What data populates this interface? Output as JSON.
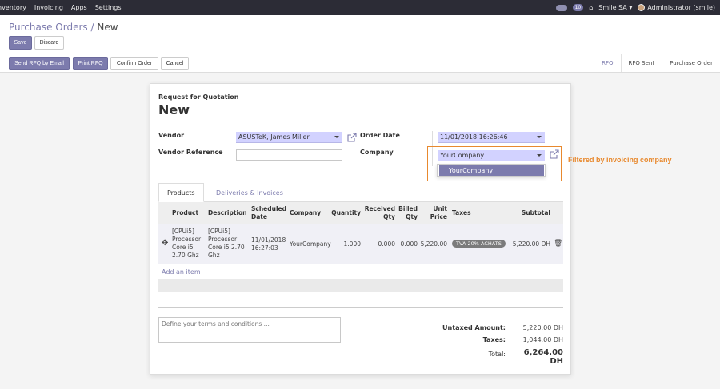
{
  "topbar": {
    "menu": [
      "nventory",
      "Invoicing",
      "Apps",
      "Settings"
    ],
    "badge_count": "10",
    "company": "Smile SA",
    "user": "Administrator (smile)"
  },
  "breadcrumb": {
    "parent": "Purchase Orders",
    "separator": "/",
    "current": "New"
  },
  "buttons": {
    "save": "Save",
    "discard": "Discard",
    "send_rfq": "Send RFQ by Email",
    "print_rfq": "Print RFQ",
    "confirm": "Confirm Order",
    "cancel": "Cancel"
  },
  "status": {
    "items": [
      "RFQ",
      "RFQ Sent",
      "Purchase Order"
    ],
    "active": "RFQ"
  },
  "form": {
    "doc_type": "Request for Quotation",
    "doc_name": "New",
    "vendor_label": "Vendor",
    "vendor_value": "ASUSTeK, James Miller",
    "vendor_ref_label": "Vendor Reference",
    "vendor_ref_value": "",
    "order_date_label": "Order Date",
    "order_date_value": "11/01/2018 16:26:46",
    "company_label": "Company",
    "company_value": "YourCompany",
    "company_dropdown_option": "YourCompany"
  },
  "tabs": [
    "Products",
    "Deliveries & Invoices"
  ],
  "table": {
    "headers": {
      "product": "Product",
      "description": "Description",
      "scheduled_1": "Scheduled",
      "scheduled_2": "Date",
      "company": "Company",
      "quantity": "Quantity",
      "received_1": "Received",
      "received_2": "Qty",
      "billed_1": "Billed",
      "billed_2": "Qty",
      "unit_1": "Unit",
      "unit_2": "Price",
      "taxes": "Taxes",
      "subtotal": "Subtotal"
    },
    "row": {
      "product_lines": [
        "[CPUi5]",
        "Processor",
        "Core i5",
        "2.70 Ghz"
      ],
      "description_lines": [
        "[CPUi5]",
        "Processor",
        "Core i5 2.70",
        "Ghz"
      ],
      "date_lines": [
        "11/01/2018",
        "16:27:03"
      ],
      "company": "YourCompany",
      "quantity": "1.000",
      "received": "0.000",
      "billed": "0.000",
      "unit_price": "5,220.00",
      "tax": "TVA 20% ACHATS",
      "subtotal": "5,220.00 DH"
    },
    "add_item": "Add an item"
  },
  "terms_placeholder": "Define your terms and conditions ...",
  "totals": {
    "untaxed_label": "Untaxed Amount:",
    "untaxed_value": "5,220.00 DH",
    "taxes_label": "Taxes:",
    "taxes_value": "1,044.00 DH",
    "total_label": "Total:",
    "total_value": "6,264.00 DH"
  },
  "annotation": "Filtered by invoicing company",
  "colors": {
    "primary": "#7c7bad",
    "navbar": "#2c2c36",
    "m2o_field": "#d2d2ff",
    "annotation": "#e8892e"
  }
}
